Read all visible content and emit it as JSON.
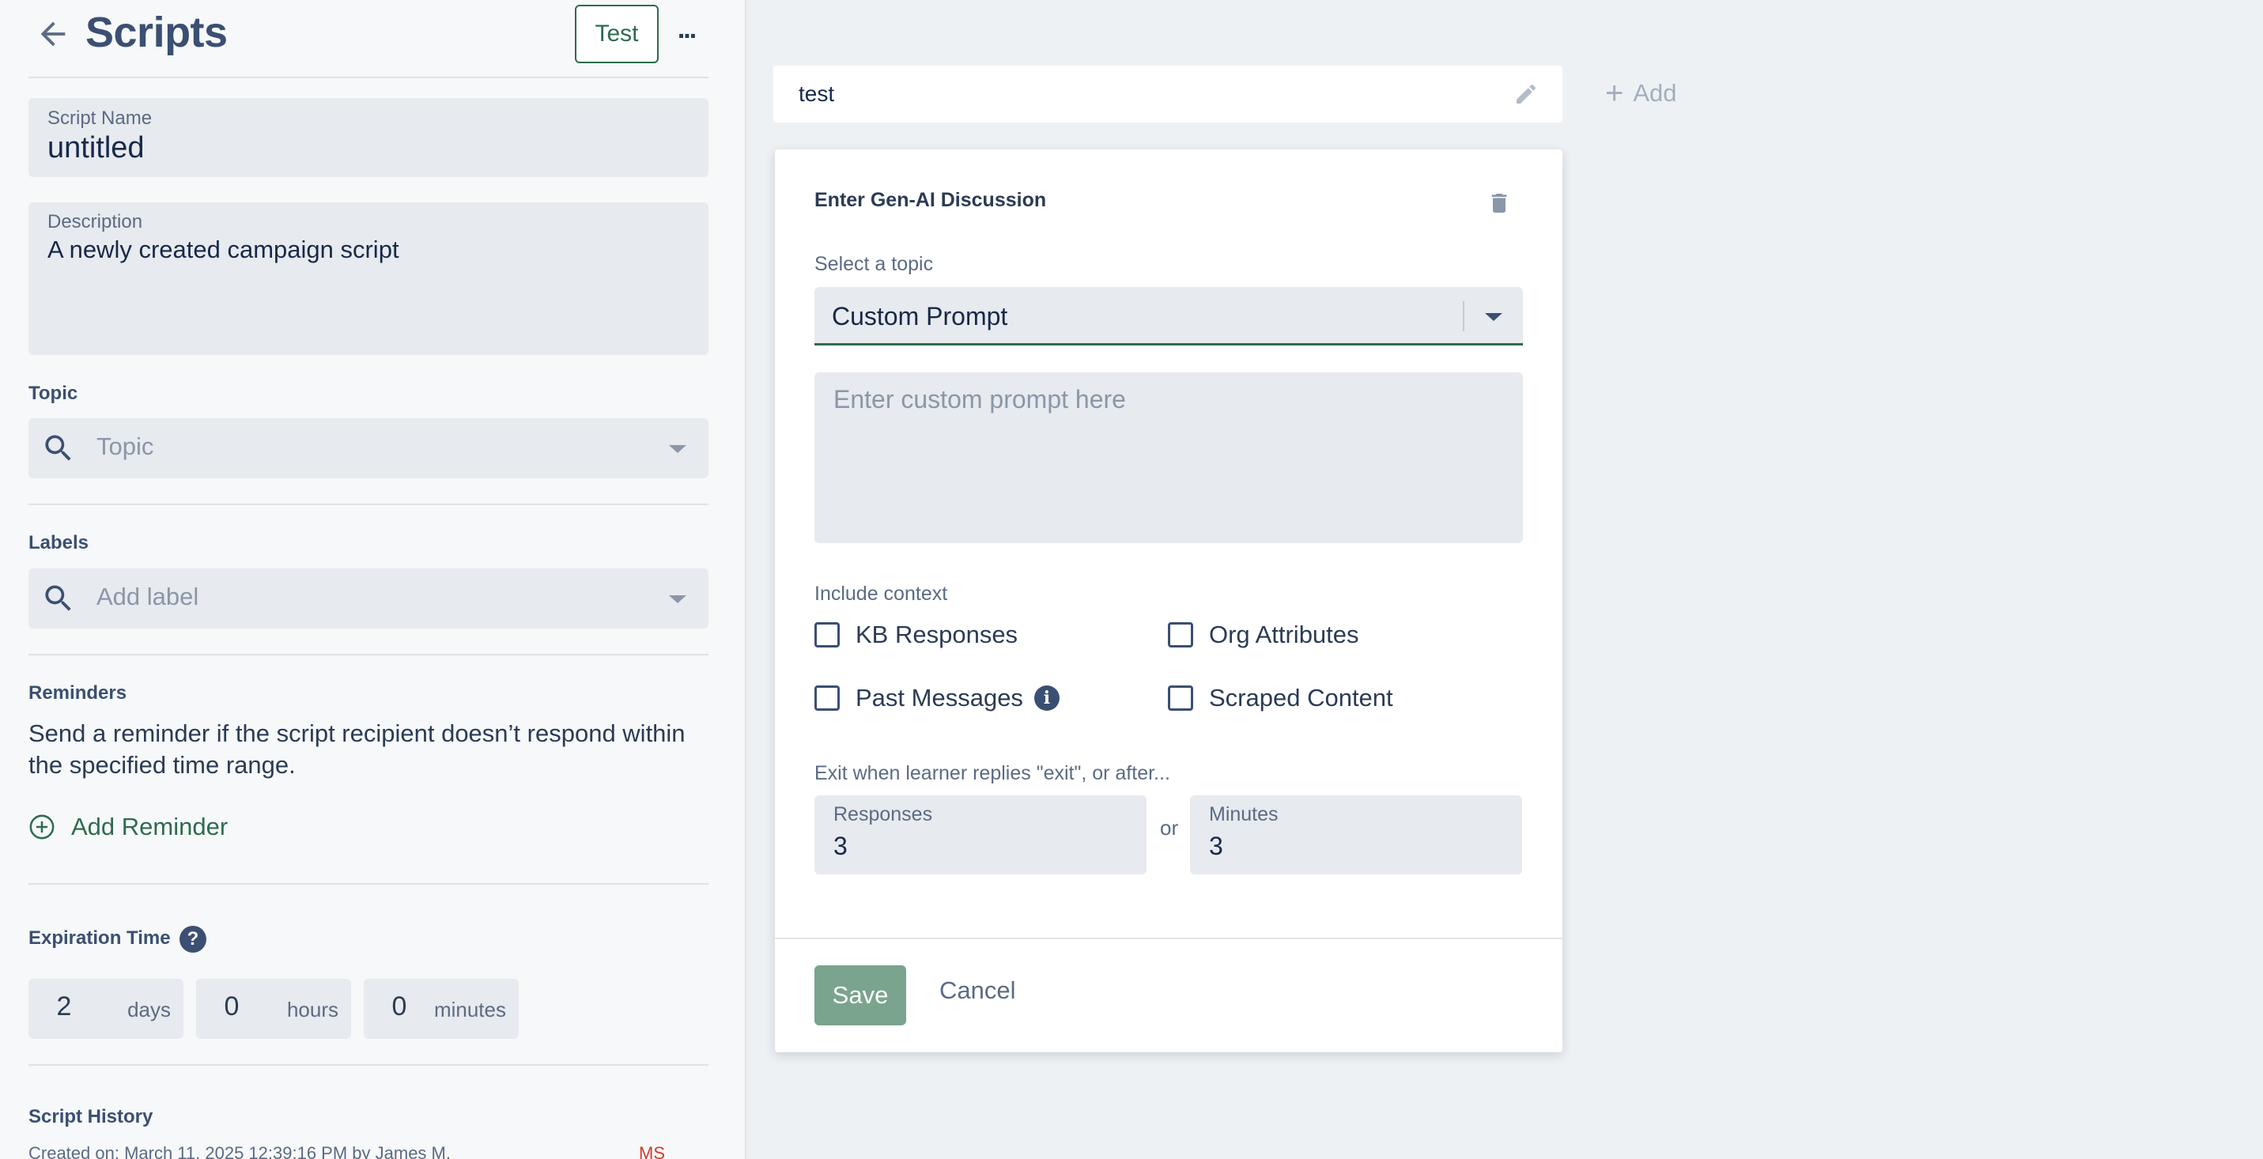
{
  "header": {
    "back_icon": "arrow-left-icon",
    "title": "Scripts",
    "test_label": "Test",
    "more_label": "..."
  },
  "script_name": {
    "label": "Script Name",
    "value": "untitled"
  },
  "description": {
    "label": "Description",
    "value": "A newly created campaign script"
  },
  "topic": {
    "label": "Topic",
    "placeholder": "Topic"
  },
  "labels": {
    "label": "Labels",
    "placeholder": "Add label"
  },
  "reminders": {
    "label": "Reminders",
    "text": "Send a reminder if the script recipient doesn’t respond within the specified time range.",
    "add_label": "Add Reminder"
  },
  "expiration": {
    "label": "Expiration Time",
    "help": "?",
    "days": {
      "value": "2",
      "unit": "days"
    },
    "hours": {
      "value": "0",
      "unit": "hours"
    },
    "minutes": {
      "value": "0",
      "unit": "minutes"
    }
  },
  "history": {
    "label": "Script History",
    "created": "Created on: March 11, 2025 12:39:16 PM  by James M.",
    "badge": "MS"
  },
  "step_tab": {
    "label": "test"
  },
  "add_step_label": "Add",
  "card": {
    "title": "Enter Gen-AI Discussion",
    "topic_label": "Select a topic",
    "topic_value": "Custom Prompt",
    "prompt_placeholder": "Enter custom prompt here",
    "context_label": "Include context",
    "context_options": [
      {
        "label": "KB Responses",
        "checked": false
      },
      {
        "label": "Org Attributes",
        "checked": false
      },
      {
        "label": "Past Messages",
        "checked": false
      },
      {
        "label": "Scraped Content",
        "checked": false
      }
    ],
    "info_icon": "i",
    "exit_label": "Exit when learner replies \"exit\", or after...",
    "responses": {
      "label": "Responses",
      "value": "3"
    },
    "or_label": "or",
    "minutes": {
      "label": "Minutes",
      "value": "3"
    },
    "save_label": "Save",
    "cancel_label": "Cancel"
  },
  "colors": {
    "accent_green": "#2f6b4f",
    "save_green": "#7aa48d",
    "navy": "#3b4f72",
    "badge_red": "#d23a2e"
  }
}
